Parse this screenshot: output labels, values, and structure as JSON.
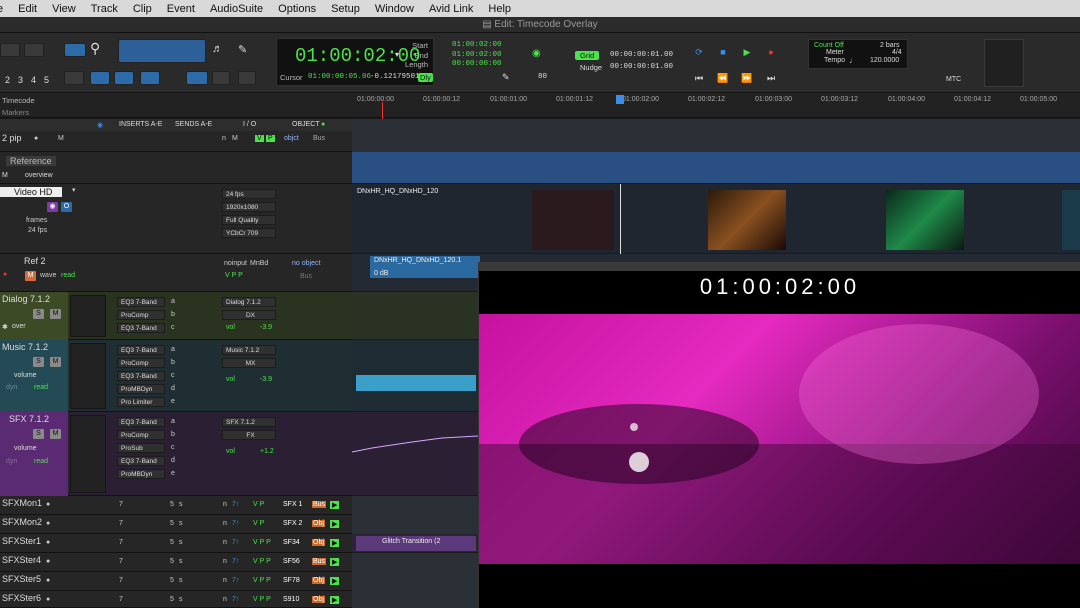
{
  "menu": [
    "e",
    "Edit",
    "View",
    "Track",
    "Clip",
    "Event",
    "AudioSuite",
    "Options",
    "Setup",
    "Window",
    "Avid Link",
    "Help"
  ],
  "window_title": "Edit: Timecode Overlay",
  "toolbar": {
    "zoom_presets": [
      "2",
      "3",
      "4",
      "5"
    ],
    "main_counter": "01:00:02:00",
    "start_label": "Start",
    "end_label": "End",
    "length_label": "Length",
    "start_value": "01:00:02:00",
    "end_value": "01:00:02:00",
    "length_value": "00:00:00:00",
    "cursor_label": "Cursor",
    "cursor_value": "01:00:00:05.06",
    "cursor_db": "-0.12179501",
    "dly_label": "Dly",
    "dly_value": "80",
    "grid_label": "Grid",
    "grid_value": "00:00:00:01.00",
    "nudge_label": "Nudge",
    "nudge_value": "00:00:00:01.00",
    "count_off": "Count Off",
    "count_off_value": "2 bars",
    "meter_label": "Meter",
    "meter_value": "4/4",
    "tempo_label": "Tempo",
    "tempo_value": "120.0000",
    "mtc_label": "MTC"
  },
  "ruler": {
    "timecode_label": "Timecode",
    "markers_label": "Markers",
    "ticks": [
      "01:00:00:00",
      "01:00:00:12",
      "01:00:01:00",
      "01:00:01:12",
      "01:00:02:00",
      "01:00:02:12",
      "01:00:03:00",
      "01:00:03:12",
      "01:00:04:00",
      "01:00:04:12",
      "01:00:05:00"
    ]
  },
  "columns": {
    "inserts": "INSERTS A-E",
    "sends": "SENDS A-E",
    "io": "I / O",
    "object": "OBJECT"
  },
  "tracks": {
    "t2pip": {
      "name": "2 pip",
      "n": "n",
      "m": "M",
      "v": "V",
      "p": "P",
      "obj": "objct",
      "bus": "Bus"
    },
    "reference": {
      "name": "Reference",
      "m": "M",
      "mode": "overview"
    },
    "video": {
      "name": "Video HD",
      "frames": "frames",
      "fps": "24 fps",
      "rate": "24 fps",
      "res": "1920x1080",
      "quality": "Full Quality",
      "color": "YCbCr 709",
      "o": "O"
    },
    "ref2": {
      "name": "Ref 2",
      "mode": "wave",
      "read": "read",
      "input": "noinput",
      "output": "MnBd",
      "object": "no object",
      "bus": "Bus"
    },
    "dialog": {
      "name": "Dialog 7.1.2",
      "s": "S",
      "m": "M",
      "mode": "over",
      "inserts": [
        "EQ3 7-Band",
        "ProComp",
        "EQ3 7-Band"
      ],
      "letters": [
        "a",
        "b",
        "c"
      ],
      "io": "Dialog 7.1.2",
      "out": "DX",
      "vol": "vol",
      "vol_val": "-3.9"
    },
    "music": {
      "name": "Music 7.1.2",
      "s": "S",
      "m": "M",
      "mode": "volume",
      "dyn": "dyn",
      "read": "read",
      "inserts": [
        "EQ3 7-Band",
        "ProComp",
        "EQ3 7-Band",
        "ProMBDyn",
        "Pro Limiter"
      ],
      "letters": [
        "a",
        "b",
        "c",
        "d",
        "e"
      ],
      "io": "Music 7.1.2",
      "out": "MX",
      "vol": "vol",
      "vol_val": "-3.9"
    },
    "sfx": {
      "name": "SFX 7.1.2",
      "s": "S",
      "m": "M",
      "mode": "volume",
      "dyn": "dyn",
      "read": "read",
      "inserts": [
        "EQ3 7-Band",
        "ProComp",
        "ProSub",
        "EQ3 7-Band",
        "ProMBDyn"
      ],
      "letters": [
        "a",
        "b",
        "c",
        "d",
        "e"
      ],
      "io": "SFX 7.1.2",
      "out": "FX",
      "vol": "vol",
      "vol_val": "+1.2"
    },
    "small": [
      {
        "name": "SFXMon1",
        "seven": "7",
        "five": "5",
        "s": "s",
        "n": "n",
        "io": "SFX 1",
        "dest": "Bus"
      },
      {
        "name": "SFXMon2",
        "seven": "7",
        "five": "5",
        "s": "s",
        "n": "n",
        "io": "SFX 2",
        "dest": "Obj"
      },
      {
        "name": "SFXSter1",
        "seven": "7",
        "five": "5",
        "s": "s",
        "n": "n",
        "io": "SF34",
        "dest": "Obj"
      },
      {
        "name": "SFXSter4",
        "seven": "7",
        "five": "5",
        "s": "s",
        "n": "n",
        "io": "SF56",
        "dest": "Bus"
      },
      {
        "name": "SFXSter5",
        "seven": "7",
        "five": "5",
        "s": "s",
        "n": "n",
        "io": "SF78",
        "dest": "Obj"
      },
      {
        "name": "SFXSter6",
        "seven": "7",
        "five": "5",
        "s": "s",
        "n": "n",
        "io": "S910",
        "dest": "Obj"
      }
    ]
  },
  "clips": {
    "video_clip": "DNxHR_HQ_DNxHD_120",
    "audio_clip": "DNxHR_HQ_DNxHD_120.1",
    "audio_gain": "0 dB",
    "glitch": "Glitch Transition (2"
  },
  "overlay": {
    "timecode": "01:00:02:00"
  },
  "colors": {
    "counter_green": "#4be34b",
    "track_blue": "#2d6aa8",
    "dialog_green": "#5a7a2a",
    "music_teal": "#2a8a9a",
    "sfx_purple": "#7a2a9a",
    "video_magenta": "#e52ac0"
  }
}
